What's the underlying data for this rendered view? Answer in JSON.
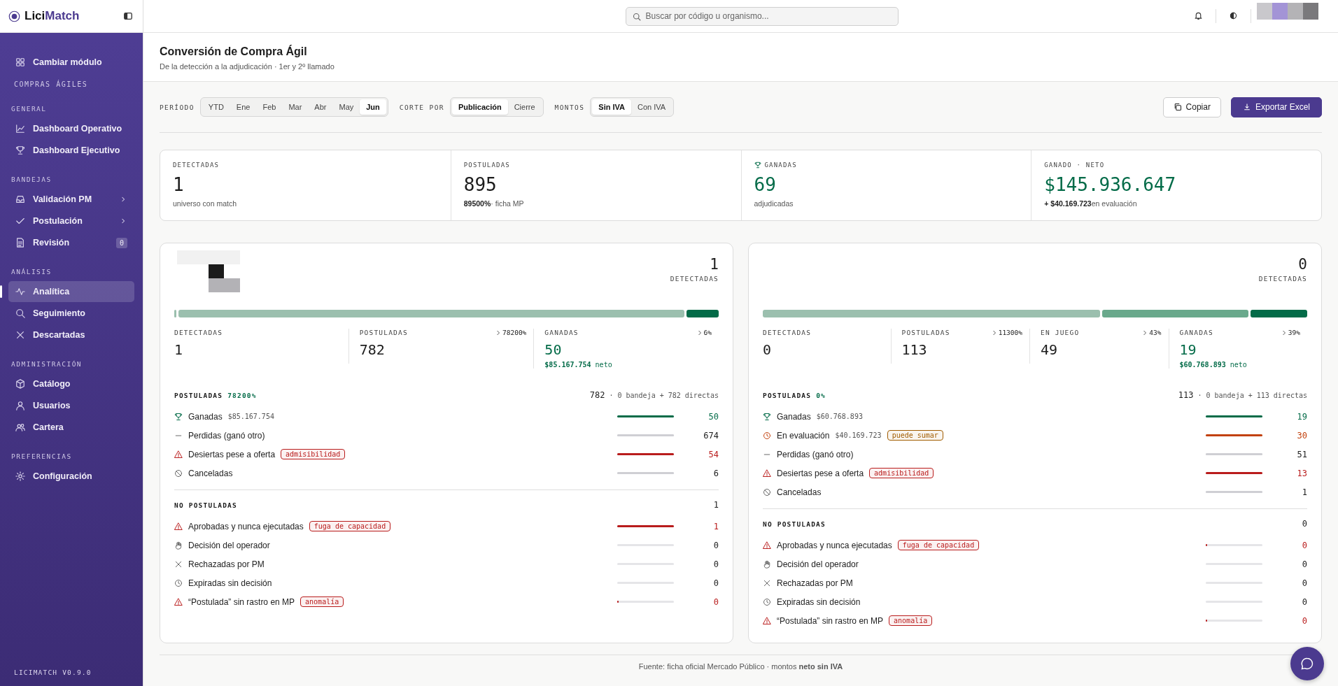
{
  "brand": {
    "prefix": "Lici",
    "suffix": "Match"
  },
  "sidebar": {
    "top_item": {
      "label": "Cambiar módulo",
      "kind": "grid"
    },
    "module": "COMPRAS ÁGILES",
    "sections": [
      {
        "title": "GENERAL",
        "items": [
          {
            "label": "Dashboard Operativo",
            "kind": "chart",
            "selected": false
          },
          {
            "label": "Dashboard Ejecutivo",
            "kind": "trophy",
            "selected": false
          }
        ]
      },
      {
        "title": "BANDEJAS",
        "items": [
          {
            "label": "Validación PM",
            "kind": "inbox",
            "selected": false,
            "expandable": true
          },
          {
            "label": "Postulación",
            "kind": "check",
            "selected": false,
            "expandable": true
          },
          {
            "label": "Revisión",
            "kind": "doc",
            "selected": false,
            "badge": "0"
          }
        ]
      },
      {
        "title": "ANÁLISIS",
        "items": [
          {
            "label": "Analítica",
            "kind": "pulse",
            "selected": true
          },
          {
            "label": "Seguimiento",
            "kind": "search",
            "selected": false
          },
          {
            "label": "Descartadas",
            "kind": "x",
            "selected": false
          }
        ]
      },
      {
        "title": "ADMINISTRACIÓN",
        "items": [
          {
            "label": "Catálogo",
            "kind": "box",
            "selected": false
          },
          {
            "label": "Usuarios",
            "kind": "user",
            "selected": false
          },
          {
            "label": "Cartera",
            "kind": "users",
            "selected": false
          }
        ]
      },
      {
        "title": "PREFERENCIAS",
        "items": [
          {
            "label": "Configuración",
            "kind": "gear",
            "selected": false
          }
        ]
      }
    ],
    "version": "LICIMATCH V0.9.0"
  },
  "search": {
    "placeholder": "Buscar por código u organismo..."
  },
  "page": {
    "title": "Conversión de Compra Ágil",
    "subtitle": "De la detección a la adjudicación · 1er y 2º llamado"
  },
  "filters": [
    {
      "label": "PERÍODO",
      "options": [
        {
          "label": "YTD",
          "selected": false
        },
        {
          "label": "Ene",
          "selected": false
        },
        {
          "label": "Feb",
          "selected": false
        },
        {
          "label": "Mar",
          "selected": false
        },
        {
          "label": "Abr",
          "selected": false
        },
        {
          "label": "May",
          "selected": false
        },
        {
          "label": "Jun",
          "selected": true
        }
      ]
    },
    {
      "label": "CORTE POR",
      "options": [
        {
          "label": "Publicación",
          "selected": true
        },
        {
          "label": "Cierre",
          "selected": false
        }
      ]
    },
    {
      "label": "MONTOS",
      "options": [
        {
          "label": "Sin IVA",
          "selected": true
        },
        {
          "label": "Con IVA",
          "selected": false
        }
      ]
    }
  ],
  "actions": {
    "copy": "Copiar",
    "export": "Exportar Excel"
  },
  "kpis": [
    {
      "kind": "count",
      "label": "DETECTADAS",
      "value": "1",
      "note": "universo con match"
    },
    {
      "kind": "count",
      "label": "POSTULADAS",
      "value": "895",
      "note_strong": "89500%",
      "note": "· ficha MP"
    },
    {
      "kind": "won",
      "label": "GANADAS",
      "value": "69",
      "note": "adjudicadas"
    },
    {
      "kind": "money",
      "label": "GANADO · NETO",
      "value": "$145.936.647",
      "note_strong": "+ $40.169.723",
      "note": "en evaluación"
    }
  ],
  "cards": [
    {
      "total": "1",
      "total_label": "DETECTADAS",
      "stages": [
        {
          "kind": "detected",
          "label": "DETECTADAS",
          "value": "1"
        },
        {
          "kind": "applied",
          "label": "POSTULADAS",
          "value": "782",
          "rate": "78200%"
        },
        {
          "kind": "won",
          "label": "GANADAS",
          "value": "50",
          "rate": "6%",
          "amount": "$85.167.754",
          "amount_unit": "neto"
        }
      ],
      "groups": [
        {
          "title": "POSTULADAS",
          "pct": "78200%",
          "count": "782",
          "detail": "· 0 bandeja + 782 directas",
          "rows": [
            {
              "kind": "trophy",
              "label": "Ganadas",
              "amount": "$85.167.754",
              "color": "#036b48",
              "level": 1,
              "value": "50"
            },
            {
              "kind": "dash",
              "label": "Perdidas (ganó otro)",
              "color": "#1c1c1c",
              "level": 1,
              "value": "674"
            },
            {
              "kind": "warn",
              "label": "Desiertas pese a oferta",
              "tag": {
                "label": "admisibilidad",
                "color": "#b91c1c"
              },
              "color": "#b91c1c",
              "level": 1,
              "value": "54"
            },
            {
              "kind": "ban",
              "label": "Canceladas",
              "color": "#1c1c1c",
              "level": 1,
              "value": "6"
            }
          ]
        },
        {
          "title": "NO POSTULADAS",
          "count": "1",
          "rows": [
            {
              "kind": "warn",
              "label": "Aprobadas y nunca ejecutadas",
              "tag": {
                "label": "fuga de capacidad",
                "color": "#b91c1c"
              },
              "color": "#b91c1c",
              "level": 1,
              "value": "1"
            },
            {
              "kind": "hand",
              "label": "Decisión del operador",
              "color": "#1c1c1c",
              "value": "0"
            },
            {
              "kind": "x",
              "label": "Rechazadas por PM",
              "color": "#1c1c1c",
              "value": "0"
            },
            {
              "kind": "clock",
              "label": "Expiradas sin decisión",
              "color": "#1c1c1c",
              "value": "0"
            },
            {
              "kind": "warn",
              "label": "“Postulada” sin rastro en MP",
              "tag": {
                "label": "anomalía",
                "color": "#b91c1c"
              },
              "color": "#b91c1c",
              "level": 0.02,
              "value": "0"
            }
          ]
        }
      ]
    },
    {
      "total": "0",
      "total_label": "DETECTADAS",
      "stages": [
        {
          "kind": "detected",
          "label": "DETECTADAS",
          "value": "0"
        },
        {
          "kind": "applied",
          "label": "POSTULADAS",
          "value": "113",
          "rate": "11300%"
        },
        {
          "kind": "in_play",
          "label": "EN JUEGO",
          "value": "49",
          "rate": "43%"
        },
        {
          "kind": "won",
          "label": "GANADAS",
          "value": "19",
          "rate": "39%",
          "amount": "$60.768.893",
          "amount_unit": "neto"
        }
      ],
      "groups": [
        {
          "title": "POSTULADAS",
          "pct": "0%",
          "count": "113",
          "detail": "· 0 bandeja + 113 directas",
          "rows": [
            {
              "kind": "trophy",
              "label": "Ganadas",
              "amount": "$60.768.893",
              "color": "#036b48",
              "level": 1,
              "value": "19"
            },
            {
              "kind": "clock",
              "label": "En evaluación",
              "amount": "$40.169.723",
              "tag": {
                "label": "puede sumar",
                "color": "#a15c00"
              },
              "color": "#c2410c",
              "level": 1,
              "value": "30"
            },
            {
              "kind": "dash",
              "label": "Perdidas (ganó otro)",
              "color": "#1c1c1c",
              "level": 1,
              "value": "51"
            },
            {
              "kind": "warn",
              "label": "Desiertas pese a oferta",
              "tag": {
                "label": "admisibilidad",
                "color": "#b91c1c"
              },
              "color": "#b91c1c",
              "level": 1,
              "value": "13"
            },
            {
              "kind": "ban",
              "label": "Canceladas",
              "color": "#1c1c1c",
              "level": 1,
              "value": "1"
            }
          ]
        },
        {
          "title": "NO POSTULADAS",
          "count": "0",
          "rows": [
            {
              "kind": "warn",
              "label": "Aprobadas y nunca ejecutadas",
              "tag": {
                "label": "fuga de capacidad",
                "color": "#b91c1c"
              },
              "color": "#b91c1c",
              "level": 0.02,
              "value": "0"
            },
            {
              "kind": "hand",
              "label": "Decisión del operador",
              "color": "#1c1c1c",
              "value": "0"
            },
            {
              "kind": "x",
              "label": "Rechazadas por PM",
              "color": "#1c1c1c",
              "value": "0"
            },
            {
              "kind": "clock",
              "label": "Expiradas sin decisión",
              "color": "#1c1c1c",
              "value": "0"
            },
            {
              "kind": "warn",
              "label": "“Postulada” sin rastro en MP",
              "tag": {
                "label": "anomalía",
                "color": "#b91c1c"
              },
              "color": "#b91c1c",
              "level": 0.02,
              "value": "0"
            }
          ]
        }
      ]
    }
  ],
  "footer": "Fuente: ficha oficial Mercado Público · montos **neto sin IVA**"
}
